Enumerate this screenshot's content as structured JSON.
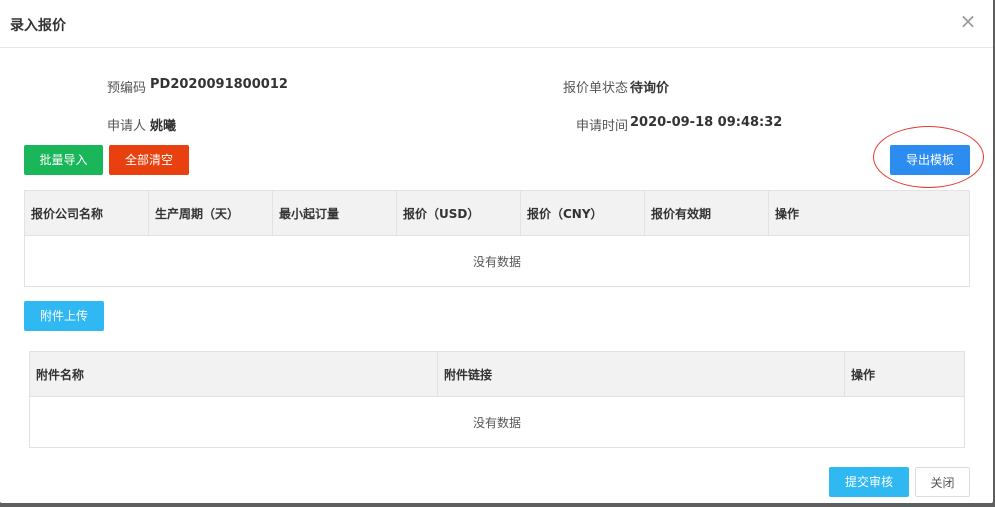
{
  "dialog": {
    "title": "录入报价",
    "close_glyph": "×"
  },
  "info": {
    "code_label": "预编码",
    "code_value": "PD2020091800012",
    "status_label": "报价单状态",
    "status_value": "待询价",
    "applicant_label": "申请人",
    "applicant_value": "姚曦",
    "apply_time_label": "申请时间",
    "apply_time_value": "2020-09-18 09:48:32"
  },
  "toolbar": {
    "batch_import_label": "批量导入",
    "clear_all_label": "全部清空",
    "export_template_label": "导出模板"
  },
  "quote_table": {
    "columns": [
      "报价公司名称",
      "生产周期（天）",
      "最小起订量",
      "报价（USD）",
      "报价（CNY）",
      "报价有效期",
      "操作"
    ],
    "empty_text": "没有数据"
  },
  "attachments": {
    "upload_label": "附件上传",
    "columns": [
      "附件名称",
      "附件链接",
      "操作"
    ],
    "empty_text": "没有数据"
  },
  "footer": {
    "submit_label": "提交审核",
    "close_label": "关闭"
  },
  "colors": {
    "green": "#1ab65a",
    "red": "#e8410f",
    "blue": "#2d8cf0",
    "cyan": "#2fb8f2",
    "highlight": "#e43a2f"
  }
}
